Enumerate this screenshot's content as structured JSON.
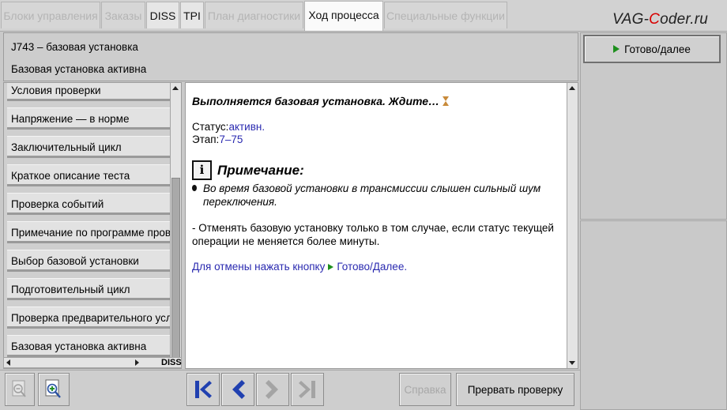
{
  "tabs": [
    {
      "label": "Блоки управления",
      "state": "disabled"
    },
    {
      "label": "Заказы",
      "state": "disabled"
    },
    {
      "label": "DISS",
      "state": "enabled"
    },
    {
      "label": "TPI",
      "state": "enabled"
    },
    {
      "label": "План диагностики",
      "state": "disabled"
    },
    {
      "label": "Ход процесса",
      "state": "active"
    },
    {
      "label": "Специальные функции",
      "state": "disabled"
    }
  ],
  "watermark": {
    "part1": "VAG-",
    "part2": "C",
    "part3": "oder.ru"
  },
  "header": {
    "line1": "J743 – базовая установка",
    "line2": "Базовая установка активна"
  },
  "ready_button": {
    "label": "Готово/далее"
  },
  "left_list": {
    "items": [
      "Условия проверки",
      "Напряжение — в норме",
      "Заключительный цикл",
      "Краткое описание теста",
      "Проверка событий",
      "Примечание по программе проверки",
      "Выбор базовой установки",
      "Подготовительный цикл",
      "Проверка предварительного условия",
      "Базовая установка активна"
    ],
    "hscroll_label": "DISS"
  },
  "content": {
    "title": "Выполняется базовая установка. Ждите…",
    "status_label": "Статус:",
    "status_value": "активн.",
    "stage_label": "Этап:",
    "stage_value": "7–75",
    "note_icon": "i",
    "note_title": "Примечание:",
    "bullet_text": "Во время базовой установки в трансмиссии слышен сильный шум переключения.",
    "paragraph": "- Отменять базовую установку только в том случае, если статус текущей операции не меняется более минуты.",
    "cancel_text": "Для отмены нажать кнопку",
    "cancel_link": "Готово/Далее."
  },
  "toolbar": {
    "help_label": "Справка",
    "abort_label": "Прервать проверку"
  },
  "colors": {
    "accent_blue": "#2a2ab0",
    "play_green": "#1d8f1d",
    "nav_blue": "#2040b0",
    "disabled_gray": "#a8a8a8"
  },
  "icons": [
    "zoom-out-icon",
    "zoom-in-icon",
    "first-page-icon",
    "previous-page-icon",
    "next-page-icon",
    "last-page-icon",
    "hourglass-icon",
    "info-icon",
    "play-icon"
  ]
}
